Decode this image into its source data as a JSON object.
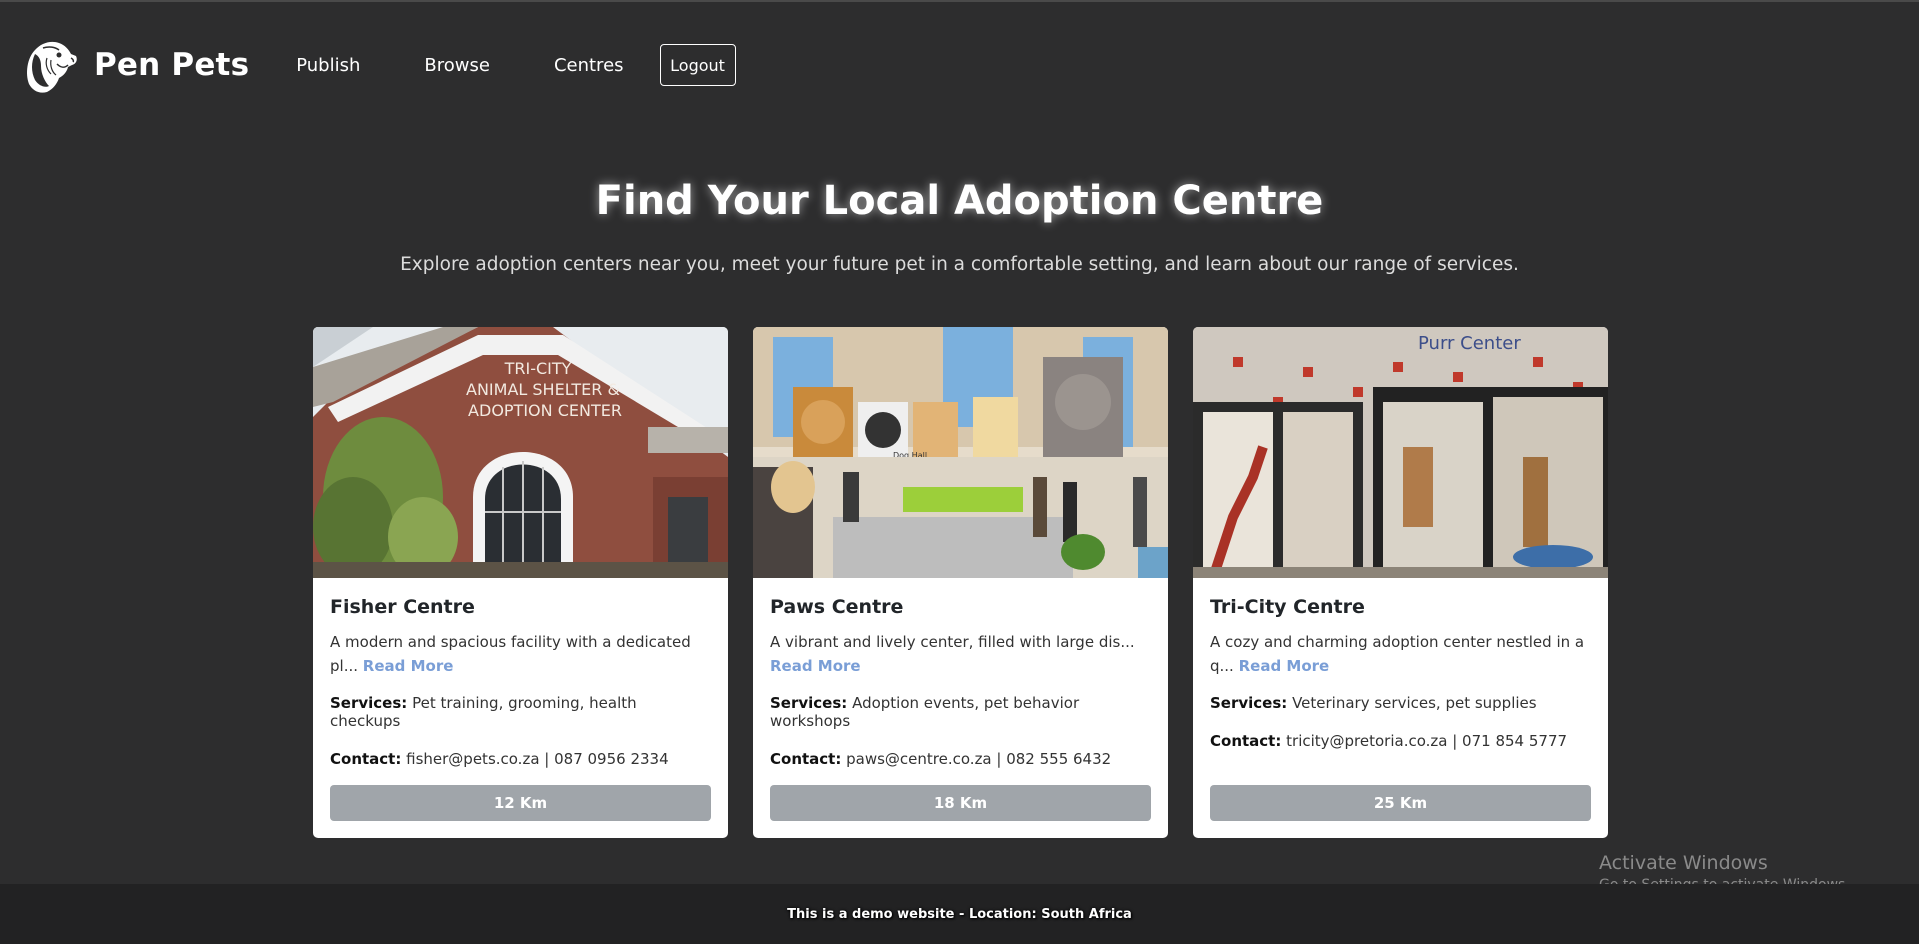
{
  "nav": {
    "brand": "Pen Pets",
    "links": [
      "Publish",
      "Browse",
      "Centres"
    ],
    "logout_label": "Logout"
  },
  "hero": {
    "title": "Find Your Local Adoption Centre",
    "subtitle": "Explore adoption centers near you, meet your future pet in a comfortable setting, and learn about our range of services."
  },
  "labels": {
    "services": "Services:",
    "contact": "Contact:",
    "read_more": "Read More"
  },
  "centres": [
    {
      "name": "Fisher Centre",
      "description": "A modern and spacious facility with a dedicated pl...",
      "services": "Pet training, grooming, health checkups",
      "contact": "fisher@pets.co.za | 087 0956 2334",
      "distance": "12 Km",
      "image_sign": [
        "TRI-CITY",
        "ANIMAL SHELTER &",
        "ADOPTION CENTER"
      ]
    },
    {
      "name": "Paws Centre",
      "description": "A vibrant and lively center, filled with large dis...",
      "services": "Adoption events, pet behavior workshops",
      "contact": "paws@centre.co.za | 082 555 6432",
      "distance": "18 Km",
      "image_sign": [
        "Dog Hall"
      ]
    },
    {
      "name": "Tri-City Centre",
      "description": "A cozy and charming adoption center nestled in a q...",
      "services": "Veterinary services, pet supplies",
      "contact": "tricity@pretoria.co.za | 071 854 5777",
      "distance": "25 Km",
      "image_sign": [
        "Purr Center"
      ]
    }
  ],
  "watermark": {
    "title": "Activate Windows",
    "subtitle": "Go to Settings to activate Windows."
  },
  "footer": {
    "text": "This is a demo website - Location: South Africa"
  }
}
